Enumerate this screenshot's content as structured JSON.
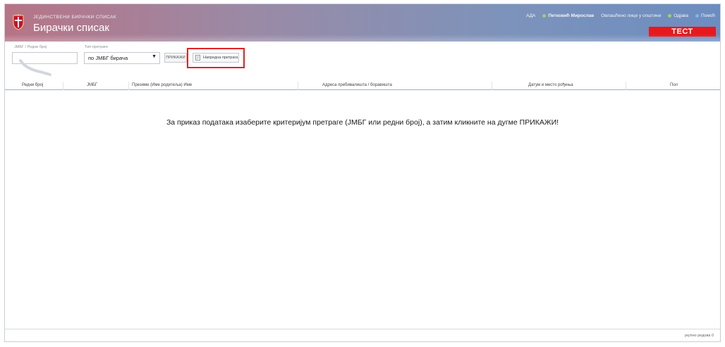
{
  "header": {
    "subtitle": "ЈЕДИНСТВЕНИ БИРАЧКИ СПИСАК",
    "title": "Бирачки списак",
    "links": {
      "role": "АДА",
      "user": "Петковић Мирослав",
      "manual": "Овлашћено лице у општини",
      "help": "Одјава",
      "logout": "Помоћ"
    },
    "badge": "ТЕСТ",
    "colors": {
      "badge": "#e8191c",
      "online_dot": "#9ed06e"
    }
  },
  "toolbar": {
    "jmbg_label": "ЈМБГ / Редни број",
    "jmbg_value": "",
    "search_type_label": "Тип претраге",
    "search_type_value": "по ЈМБГ бирача",
    "show_button": "ПРИКАЖИ",
    "advanced_search": "Напредна претрага",
    "highlight_color": "#e02227"
  },
  "table": {
    "columns": [
      "Редни број",
      "ЈМБГ",
      "Презиме (Име родитеља) Име",
      "Адреса пребивалишта / боравишта",
      "Датум и место рођења",
      "Пол"
    ],
    "empty_message": "За приказ података изаберите критеријум претраге (ЈМБГ или редни број), а затим кликните на дугме ПРИКАЖИ!",
    "row_count": "укупно редова 0"
  }
}
